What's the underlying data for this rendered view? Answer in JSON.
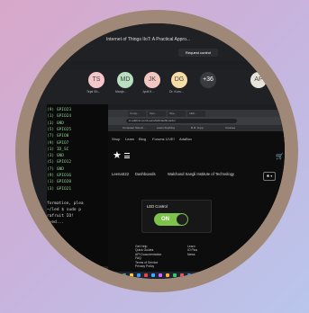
{
  "meet": {
    "title": "Internet of Things IIoT: A Practical Appro...",
    "request_control": "Request control",
    "participants": [
      {
        "initials": "TS",
        "name": "Tejal Sh...",
        "color": "#f4c6c9"
      },
      {
        "initials": "MD",
        "name": "Manje...",
        "color": "#b8dfc0"
      },
      {
        "initials": "JK",
        "name": "Jyoti K...",
        "color": "#f3c7c1"
      },
      {
        "initials": "DG",
        "name": "Dr. Kum...",
        "color": "#f6dca6"
      },
      {
        "initials": "+36",
        "name": "",
        "color": "#3a3b3e"
      },
      {
        "initials": "AP",
        "name": "",
        "color": "#e7e3d8"
      }
    ]
  },
  "terminal": {
    "lines": [
      "(9) GPIO23",
      "(1) GPIO24",
      "(3) GND",
      "(5) GPIO25",
      "(7) GPIO8",
      "(9) GPIO7",
      "(1) ID_SC",
      "(3) GND",
      "(5) GPIO12",
      "(7) GND",
      "(9) GPIO16",
      "(1) GPIO20",
      "(3) GPIO21"
    ],
    "code": [
      "formation, plea",
      "~/led $ sudo p",
      "rafruit IO!",
      "ived..."
    ]
  },
  "browser": {
    "tabs": [
      "Comp...",
      "Ope...",
      "Ope...",
      "LED..."
    ],
    "url": "io.adafruit.com/LeenaS22/dashboards/",
    "bookmarks": [
      "Computer Scienc...",
      "Learn Anything",
      "R.R. Impp",
      "Courses"
    ],
    "nav": [
      "Shop",
      "Learn",
      "Blog",
      "Forums",
      "LIVE!",
      "AdaBox"
    ],
    "breadcrumb": [
      "LeenaS22",
      "Dashboards",
      "Walchand Sangli Institute of Technology"
    ],
    "tool_btn": "✱ ▾",
    "led_card": {
      "title": "LED Control",
      "state": "ON"
    },
    "footer_col1": [
      "Get Help",
      "Quick Guides",
      "API Documentation",
      "FAQ",
      "Terms of Service",
      "Privacy Policy"
    ],
    "footer_col2": [
      "Learn",
      "IO Plus",
      "News"
    ],
    "social": [
      "◎",
      "🐦",
      "f",
      "▶"
    ]
  },
  "colors": {
    "border": "#a08878",
    "switch_on": "#7dc24b"
  }
}
